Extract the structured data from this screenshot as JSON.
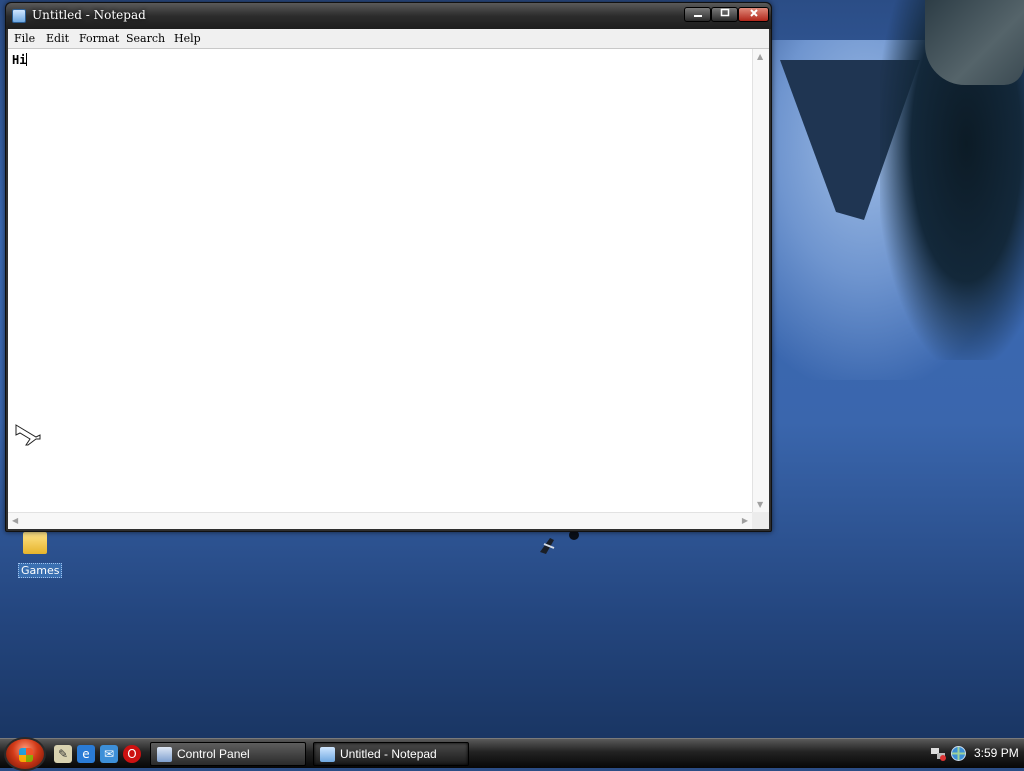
{
  "desktop": {
    "icons": [
      {
        "label": "Games",
        "icon": "folder-icon"
      }
    ]
  },
  "notepad": {
    "title": "Untitled - Notepad",
    "app_icon": "notepad-icon",
    "menu": [
      "File",
      "Edit",
      "Format",
      "Search",
      "Help"
    ],
    "content": "Hi",
    "controls": {
      "minimize": "minimize-icon",
      "maximize": "maximize-icon",
      "close": "close-icon"
    }
  },
  "taskbar": {
    "quick_launch": [
      "pen-tool-icon",
      "internet-explorer-icon",
      "mail-icon",
      "opera-icon"
    ],
    "tasks": [
      {
        "label": "Control Panel",
        "icon": "control-panel-icon",
        "active": false
      },
      {
        "label": "Untitled - Notepad",
        "icon": "notepad-icon",
        "active": true
      }
    ],
    "tray": [
      "network-icon",
      "globe-icon"
    ],
    "clock": "3:59 PM"
  },
  "colors": {
    "close_button": "#c0392b",
    "taskbar": "#1a1a1a",
    "desktop_blue": "#3a66ad"
  }
}
